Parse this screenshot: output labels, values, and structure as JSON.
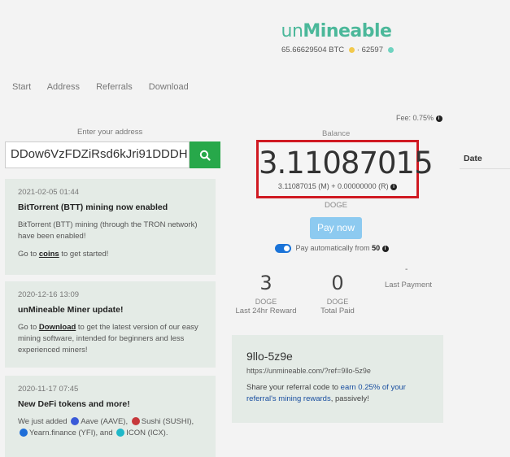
{
  "header": {
    "logo_prefix": "un",
    "logo_main": "Mineable",
    "btc_value": "65.66629504 BTC",
    "count": "62597"
  },
  "nav": {
    "items": [
      "Start",
      "Address",
      "Referrals",
      "Download"
    ]
  },
  "fee": "Fee: 0.75%",
  "address": {
    "label": "Enter your address",
    "value": "DDow6VzFDZiRsd6kJri91DDDH"
  },
  "news": [
    {
      "date": "2021-02-05 01:44",
      "title": "BitTorrent (BTT) mining now enabled",
      "body": "BitTorrent (BTT) mining (through the TRON network) have been enabled!",
      "cta_prefix": "Go to",
      "cta_link": "coins",
      "cta_suffix": "to get started!"
    },
    {
      "date": "2020-12-16 13:09",
      "title": "unMineable Miner update!",
      "cta_prefix": "Go to",
      "cta_link": "Download",
      "body": "to get the latest version of our easy mining software, intended for beginners and less experienced miners!"
    },
    {
      "date": "2020-11-17 07:45",
      "title": "New DeFi tokens and more!",
      "body_1": "We just added",
      "token_1": "Aave (AAVE),",
      "token_2": "Sushi (SUSHI),",
      "token_3": "Yearn.finance (YFI),",
      "joiner": "and",
      "token_4": "ICON (ICX)."
    }
  ],
  "balance": {
    "label": "Balance",
    "amount": "3.11087015",
    "breakdown": "3.11087015 (M) + 0.00000000 (R)",
    "coin": "DOGE",
    "pay_now": "Pay now",
    "auto_pay_label": "Pay automatically from",
    "auto_pay_threshold": "50"
  },
  "stats": {
    "reward_value": "3",
    "reward_unit": "DOGE",
    "reward_label": "Last 24hr Reward",
    "paid_value": "0",
    "paid_unit": "DOGE",
    "paid_label": "Total Paid",
    "last_payment_value": "-",
    "last_payment_label": "Last Payment"
  },
  "referral": {
    "code": "9llo-5z9e",
    "url": "https://unmineable.com/?ref=9llo-5z9e",
    "text_prefix": "Share your referral code to",
    "text_link": "earn 0.25% of your referral's mining rewards",
    "text_suffix": ", passively!"
  },
  "table": {
    "date_header": "Date"
  },
  "colors": {
    "brand": "#4bb89a",
    "search_button": "#27a84a",
    "highlight_border": "#d01a22",
    "pay_button": "#8dcaf0",
    "toggle": "#1a73d8"
  }
}
